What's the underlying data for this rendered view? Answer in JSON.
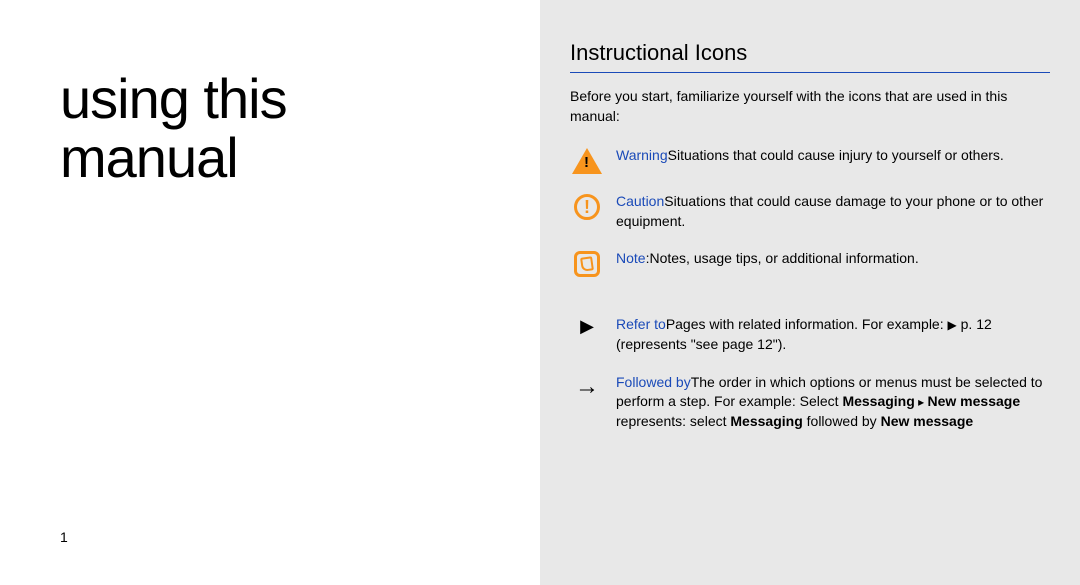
{
  "left": {
    "title_line1": "using this",
    "title_line2": "manual",
    "page_number": "1"
  },
  "right": {
    "heading": "Instructional Icons",
    "intro": "Before you start, familiarize yourself with the icons that are used in this manual:",
    "items": [
      {
        "icon": "warning",
        "label": "Warning",
        "label_sep": "—",
        "text": "Situations that could cause injury to yourself or others."
      },
      {
        "icon": "caution",
        "label": "Caution",
        "label_sep": "—",
        "text": "Situations that could cause damage to your phone or to other equipment."
      },
      {
        "icon": "note",
        "label": "Note",
        "label_sep": ":",
        "text": "Notes, usage tips, or additional information."
      },
      {
        "icon": "refer",
        "label": "Refer to",
        "label_sep": "—",
        "text_pre": "Pages with related information. For example: ",
        "text_post": " p. 12 (represents \"see page 12\")."
      },
      {
        "icon": "followed",
        "label": "Followed by",
        "label_sep": "—",
        "text_pre": "The order in which options or menus must be selected to perform a step. For example: Select ",
        "bold1": "Messaging",
        "mid1": " ",
        "bold2": "New message",
        "text_mid": " represents: select ",
        "bold3": "Messaging",
        "text_mid2": " followed by ",
        "bold4": "New message"
      }
    ]
  }
}
